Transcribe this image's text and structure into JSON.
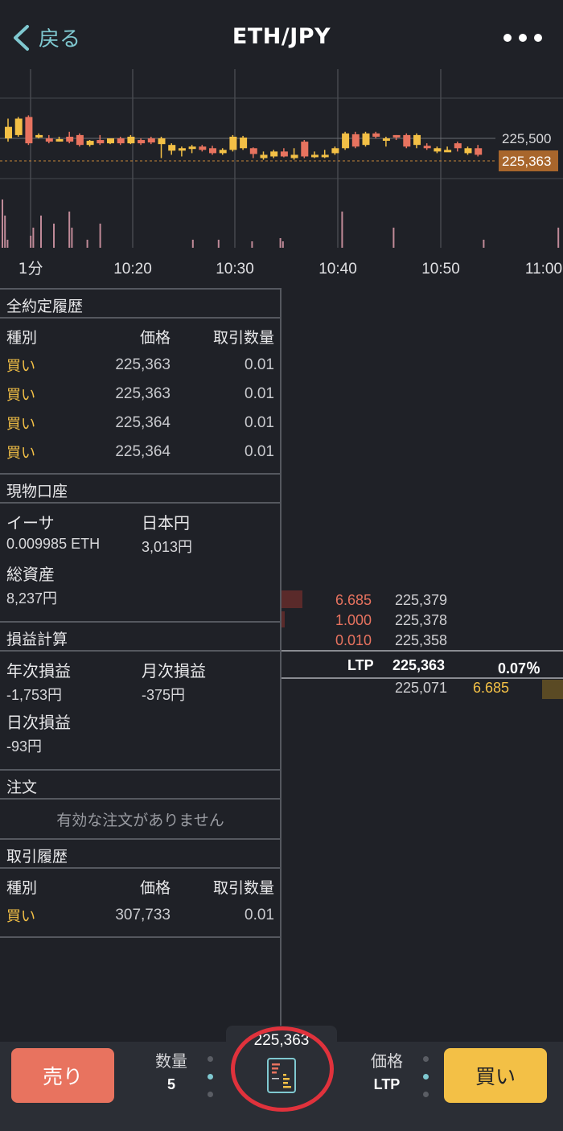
{
  "header": {
    "back_label": "戻る",
    "title": "ETH/JPY",
    "more_icon": "more-icon"
  },
  "chart": {
    "price_labels": [
      "225,500",
      "225,363"
    ],
    "interval_label": "1分",
    "time_labels": [
      "10:20",
      "10:30",
      "10:40",
      "10:50",
      "11:00"
    ],
    "candles": [
      [
        0,
        0,
        225570,
        225500,
        225620,
        225480
      ],
      [
        1,
        0,
        225520,
        225620,
        225630,
        225510
      ],
      [
        2,
        1,
        225630,
        225470,
        225640,
        225460
      ],
      [
        3,
        0,
        225510,
        225520,
        225530,
        225500
      ],
      [
        4,
        1,
        225500,
        225480,
        225520,
        225470
      ],
      [
        5,
        0,
        225490,
        225495,
        225510,
        225480
      ],
      [
        6,
        1,
        225480,
        225510,
        225540,
        225470
      ],
      [
        7,
        1,
        225520,
        225460,
        225530,
        225450
      ],
      [
        8,
        0,
        225460,
        225485,
        225490,
        225450
      ],
      [
        9,
        1,
        225490,
        225470,
        225520,
        225460
      ],
      [
        10,
        0,
        225470,
        225500,
        225500,
        225465
      ],
      [
        11,
        1,
        225500,
        225470,
        225510,
        225460
      ],
      [
        12,
        0,
        225470,
        225510,
        225520,
        225465
      ],
      [
        13,
        1,
        225490,
        225470,
        225500,
        225460
      ],
      [
        14,
        1,
        225475,
        225500,
        225510,
        225465
      ],
      [
        15,
        0,
        225500,
        225465,
        225510,
        225380
      ],
      [
        16,
        0,
        225460,
        225425,
        225470,
        225400
      ],
      [
        17,
        0,
        225430,
        225440,
        225450,
        225390
      ],
      [
        18,
        0,
        225445,
        225450,
        225460,
        225410
      ],
      [
        19,
        1,
        225450,
        225430,
        225460,
        225420
      ],
      [
        20,
        1,
        225440,
        225410,
        225455,
        225400
      ],
      [
        21,
        0,
        225410,
        225430,
        225440,
        225400
      ],
      [
        22,
        0,
        225430,
        225510,
        225520,
        225420
      ],
      [
        23,
        0,
        225505,
        225440,
        225515,
        225430
      ],
      [
        24,
        1,
        225440,
        225405,
        225445,
        225380
      ],
      [
        25,
        0,
        225400,
        225380,
        225420,
        225370
      ],
      [
        26,
        0,
        225390,
        225420,
        225430,
        225380
      ],
      [
        27,
        1,
        225420,
        225390,
        225440,
        225385
      ],
      [
        28,
        0,
        225400,
        225380,
        225440,
        225370
      ],
      [
        29,
        1,
        225390,
        225480,
        225490,
        225380
      ],
      [
        30,
        0,
        225400,
        225390,
        225420,
        225380
      ],
      [
        31,
        0,
        225390,
        225400,
        225430,
        225380
      ],
      [
        32,
        0,
        225410,
        225440,
        225450,
        225400
      ],
      [
        33,
        0,
        225440,
        225530,
        225540,
        225430
      ],
      [
        34,
        1,
        225525,
        225450,
        225540,
        225440
      ],
      [
        35,
        0,
        225460,
        225530,
        225540,
        225450
      ],
      [
        36,
        1,
        225530,
        225510,
        225540,
        225500
      ],
      [
        37,
        0,
        225500,
        225490,
        225510,
        225450
      ],
      [
        38,
        1,
        225510,
        225520,
        225520,
        225490
      ],
      [
        39,
        1,
        225520,
        225450,
        225530,
        225440
      ],
      [
        40,
        0,
        225460,
        225520,
        225530,
        225440
      ],
      [
        41,
        1,
        225455,
        225440,
        225470,
        225430
      ],
      [
        42,
        0,
        225420,
        225440,
        225450,
        225410
      ],
      [
        43,
        0,
        225430,
        225425,
        225450,
        225420
      ],
      [
        44,
        1,
        225440,
        225470,
        225480,
        225420
      ],
      [
        45,
        0,
        225440,
        225410,
        225450,
        225400
      ],
      [
        46,
        1,
        225440,
        225400,
        225460,
        225390
      ]
    ],
    "volumes": [
      60,
      40,
      10,
      0,
      0,
      0,
      0,
      0,
      0,
      0,
      0,
      15,
      25,
      0,
      0,
      40,
      0,
      0,
      0,
      0,
      30,
      0,
      0,
      0,
      0,
      0,
      45,
      25,
      0,
      0,
      0,
      0,
      0,
      10,
      0,
      0,
      0,
      0,
      30,
      0,
      0,
      0,
      0,
      0,
      0,
      0,
      0,
      0,
      0,
      0,
      0,
      0,
      0,
      0,
      0,
      0,
      0,
      0,
      0,
      0,
      0,
      0,
      0,
      0,
      0,
      0,
      0,
      0,
      0,
      0,
      0,
      0,
      0,
      0,
      10,
      0,
      0,
      0,
      0,
      0,
      0,
      0,
      0,
      0,
      10,
      0,
      0,
      0,
      0,
      0,
      0,
      0,
      0,
      0,
      0,
      0,
      0,
      8,
      0,
      0,
      0,
      0,
      0,
      0,
      0,
      0,
      0,
      0,
      12,
      8,
      0,
      0,
      0,
      0,
      0,
      0,
      0,
      0,
      0,
      0,
      0,
      0,
      0,
      0,
      0,
      0,
      0,
      0,
      0,
      0,
      0,
      0,
      45,
      0,
      0,
      0,
      0,
      0,
      0,
      0,
      0,
      0,
      0,
      0,
      0,
      0,
      0,
      0,
      0,
      0,
      0,
      0,
      25,
      0,
      0,
      0,
      0,
      0,
      0,
      0,
      0,
      0,
      0,
      0,
      0,
      0,
      0,
      0,
      0,
      0,
      0,
      0,
      0,
      0,
      0,
      0,
      0,
      0,
      0,
      0,
      0,
      0,
      0,
      0,
      0,
      0,
      0,
      10,
      0,
      0,
      0,
      0,
      0,
      0,
      0,
      0,
      0,
      0,
      0,
      0,
      0,
      0,
      0,
      0,
      0,
      0,
      0,
      0,
      0,
      0,
      0,
      0,
      0,
      0,
      0,
      0,
      25,
      0,
      0,
      0,
      0,
      0,
      0,
      0,
      0,
      0
    ]
  },
  "trades_all": {
    "title": "全約定履歴",
    "headers": [
      "種別",
      "価格",
      "取引数量"
    ],
    "rows": [
      {
        "side": "買い",
        "price": "225,363",
        "qty": "0.01"
      },
      {
        "side": "買い",
        "price": "225,363",
        "qty": "0.01"
      },
      {
        "side": "買い",
        "price": "225,364",
        "qty": "0.01"
      },
      {
        "side": "買い",
        "price": "225,364",
        "qty": "0.01"
      }
    ]
  },
  "account": {
    "title": "現物口座",
    "eth_label": "イーサ",
    "eth_value": "0.009985 ETH",
    "jpy_label": "日本円",
    "jpy_value": "3,013",
    "jpy_unit": "円",
    "total_label": "総資産",
    "total_value": "8,237",
    "total_unit": "円"
  },
  "pnl": {
    "title": "損益計算",
    "year_label": "年次損益",
    "year_value": "-1,753",
    "year_unit": "円",
    "month_label": "月次損益",
    "month_value": "-375",
    "month_unit": "円",
    "day_label": "日次損益",
    "day_value": "-93",
    "day_unit": "円"
  },
  "orders": {
    "title": "注文",
    "empty_text": "有効な注文がありません"
  },
  "history": {
    "title": "取引履歴",
    "headers": [
      "種別",
      "価格",
      "取引数量"
    ],
    "rows": [
      {
        "side": "買い",
        "price": "307,733",
        "qty": "0.01"
      }
    ]
  },
  "book": {
    "asks": [
      {
        "size": "6.685",
        "price": "225,379"
      },
      {
        "size": "1.000",
        "price": "225,378"
      },
      {
        "size": "0.010",
        "price": "225,358"
      }
    ],
    "ltp_label": "LTP",
    "ltp_price": "225,363",
    "ltp_change": "0.07％",
    "bids": [
      {
        "price": "225,071",
        "size": "6.685"
      }
    ]
  },
  "bottom": {
    "sell_label": "売り",
    "buy_label": "買い",
    "qty_label": "数量",
    "qty_value": "5",
    "price_label": "価格",
    "price_value": "LTP",
    "center_price": "225,363"
  },
  "colors": {
    "sell": "#e8735f",
    "buy": "#f3c046",
    "accent": "#7fc8d0",
    "bg": "#1f2127",
    "highlight_ring": "#e0323c"
  }
}
